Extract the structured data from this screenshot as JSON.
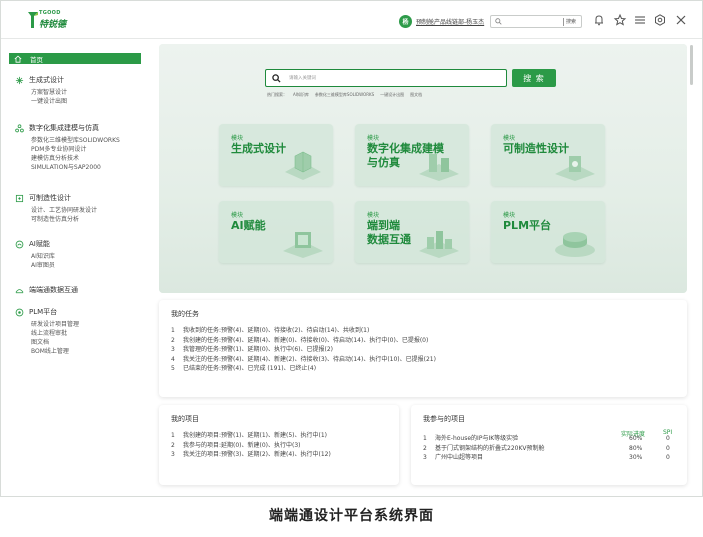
{
  "header": {
    "brand_top": "TGOOD",
    "brand_main": "特锐德",
    "user_avatar": "杨",
    "user_name": "预制舱产品线链部-杨玉杰",
    "search_button": "搜索",
    "icons": [
      "bell-icon",
      "star-icon",
      "menu-icon",
      "settings-icon",
      "close-icon"
    ]
  },
  "sidebar": {
    "home": "首页",
    "groups": [
      {
        "title": "生成式设计",
        "icon": "generative-icon",
        "items": [
          "方案智慧设计",
          "一键设计出图"
        ]
      },
      {
        "title": "数字化集成建模与仿真",
        "icon": "modeling-icon",
        "items": [
          "参数化三维模型库SOLIDWORKS",
          "PDM多专业协同设计",
          "建模仿真分析技术",
          "SIMULATION与SAP2000"
        ]
      },
      {
        "title": "可制造性设计",
        "icon": "manufacturing-icon",
        "items": [
          "设计、工艺协同研发设计",
          "可制造性仿真分析"
        ]
      },
      {
        "title": "AI赋能",
        "icon": "ai-icon",
        "items": [
          "AI知识库",
          "AI审图员"
        ]
      },
      {
        "title": "端端通数据互通",
        "icon": "data-icon",
        "items": []
      },
      {
        "title": "PLM平台",
        "icon": "plm-icon",
        "items": [
          "研发设计项目管理",
          "线上流程审批",
          "图文档",
          "BOM线上管理"
        ]
      }
    ]
  },
  "hero": {
    "search_placeholder": "请输入关键词",
    "search_button": "搜 索",
    "hot_label": "热门搜索：",
    "hot_items": [
      "AI知识库",
      "参数化三维模型库SOLIDWORKS",
      "一键设计出图",
      "图文档"
    ],
    "tiles": [
      {
        "tag": "模块",
        "name_line1": "生成式设计",
        "name_line2": ""
      },
      {
        "tag": "模块",
        "name_line1": "数字化集成建模",
        "name_line2": "与仿真"
      },
      {
        "tag": "模块",
        "name_line1": "可制造性设计",
        "name_line2": ""
      },
      {
        "tag": "模块",
        "name_line1": "AI赋能",
        "name_line2": ""
      },
      {
        "tag": "模块",
        "name_line1": "端到端",
        "name_line2": "数据互通"
      },
      {
        "tag": "模块",
        "name_line1": "PLM平台",
        "name_line2": ""
      }
    ]
  },
  "tasks": {
    "title": "我的任务",
    "rows": [
      {
        "num": "1",
        "text": "我收到的任务:预警(4)、延期(0)、待接收(2)、待启动(14)、共收到(1)"
      },
      {
        "num": "2",
        "text": "我创建的任务:预警(4)、延期(4)、新建(0)、待接收(0)、待启动(14)、执行中(0)、已提报(0)"
      },
      {
        "num": "3",
        "text": "我管理的任务:预警(1)、延期(0)、执行中(6)、已提报(2)"
      },
      {
        "num": "4",
        "text": "我关注的任务:预警(4)、延期(4)、新建(2)、待接收(3)、待启动(14)、执行中(10)、已提报(21)"
      },
      {
        "num": "5",
        "text": "已结束的任务:预警(4)、已完成 (191)、已终止(4)"
      }
    ]
  },
  "my_projects": {
    "title": "我的项目",
    "rows": [
      {
        "num": "1",
        "text": "我创建的项目:预警(1)、延期(1)、新建(5)、执行中(1)"
      },
      {
        "num": "2",
        "text": "我参与的项目:延期(0)、新建(0)、执行中(3)"
      },
      {
        "num": "3",
        "text": "我关注的项目:预警(3)、延期(2)、新建(4)、执行中(12)"
      }
    ]
  },
  "joined_projects": {
    "title": "我参与的项目",
    "col_progress": "实际进度",
    "col_spi": "SPI",
    "rows": [
      {
        "num": "1",
        "name": "海外E-house的IP与IK等级实验",
        "progress": "60%",
        "spi": "0"
      },
      {
        "num": "2",
        "name": "基于门式钢架结构的折叠式220KV预制舱",
        "progress": "80%",
        "spi": "0"
      },
      {
        "num": "3",
        "name": "广州中山超等项目",
        "progress": "30%",
        "spi": "0"
      }
    ]
  },
  "caption": "端端通设计平台系统界面",
  "colors": {
    "accent": "#2b9a47",
    "accent_dark": "#1f8a3c",
    "hero_bg": "#e4eee7"
  }
}
